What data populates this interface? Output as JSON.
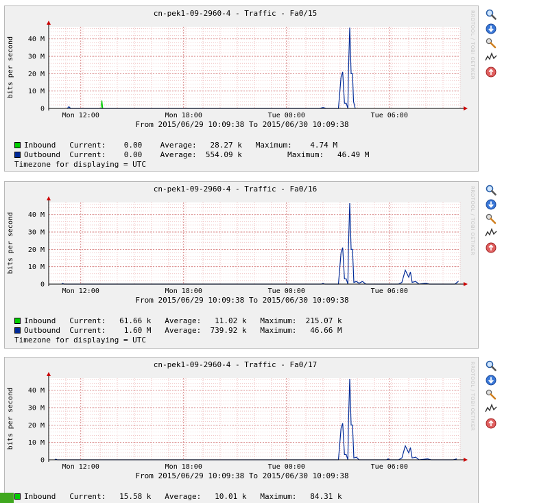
{
  "watermark": "RRDTOOL / TOBI OETIKER",
  "ylabel": "bits per second",
  "colors": {
    "inbound": "#00cc00",
    "outbound": "#002a97",
    "grid": "#e8a0a0",
    "axis": "#cc0000",
    "background": "#f0f0f0"
  },
  "actions": [
    {
      "name": "zoom-icon"
    },
    {
      "name": "download-icon"
    },
    {
      "name": "properties-icon"
    },
    {
      "name": "graph-icon"
    },
    {
      "name": "delete-icon"
    }
  ],
  "graphs": [
    {
      "title": "cn-pek1-09-2960-4 - Traffic - Fa0/15",
      "daterange": "From 2015/06/29 10:09:38 To 2015/06/30 10:09:38",
      "inbound": "Inbound   Current:    0.00    Average:   28.27 k   Maximum:    4.74 M",
      "outbound": "Outbound  Current:    0.00    Average:  554.09 k          Maximum:   46.49 M",
      "timezone": "Timezone for displaying = UTC"
    },
    {
      "title": "cn-pek1-09-2960-4 - Traffic - Fa0/16",
      "daterange": "From 2015/06/29 10:09:38 To 2015/06/30 10:09:38",
      "inbound": "Inbound   Current:   61.66 k   Average:   11.02 k   Maximum:  215.07 k",
      "outbound": "Outbound  Current:    1.60 M   Average:  739.92 k   Maximum:   46.66 M",
      "timezone": "Timezone for displaying = UTC"
    },
    {
      "title": "cn-pek1-09-2960-4 - Traffic - Fa0/17",
      "daterange": "From 2015/06/29 10:09:38 To 2015/06/30 10:09:38",
      "inbound": "Inbound   Current:   15.58 k   Average:   10.01 k   Maximum:   84.31 k"
    }
  ],
  "chart_data": [
    {
      "type": "line",
      "xlabels": [
        "Mon 12:00",
        "Mon 18:00",
        "Tue 00:00",
        "Tue 06:00"
      ],
      "ylabels": [
        "0",
        "10 M",
        "20 M",
        "30 M",
        "40 M"
      ],
      "ylim": [
        0,
        47
      ],
      "xlim_hours": [
        0,
        24
      ],
      "series": [
        {
          "name": "Inbound",
          "points": [
            [
              3.05,
              0
            ],
            [
              3.1,
              4.6
            ],
            [
              3.15,
              0
            ]
          ]
        },
        {
          "name": "Outbound",
          "points": [
            [
              1.08,
              0
            ],
            [
              1.18,
              1
            ],
            [
              1.28,
              0
            ],
            [
              15.8,
              0
            ],
            [
              16.0,
              0.5
            ],
            [
              16.2,
              0
            ],
            [
              16.9,
              0
            ],
            [
              17.05,
              18
            ],
            [
              17.15,
              21
            ],
            [
              17.25,
              3
            ],
            [
              17.35,
              3
            ],
            [
              17.45,
              0
            ],
            [
              17.48,
              20
            ],
            [
              17.56,
              46.5
            ],
            [
              17.64,
              20
            ],
            [
              17.72,
              20
            ],
            [
              17.78,
              4
            ],
            [
              17.88,
              0
            ]
          ]
        }
      ]
    },
    {
      "type": "line",
      "xlabels": [
        "Mon 12:00",
        "Mon 18:00",
        "Tue 00:00",
        "Tue 06:00"
      ],
      "ylabels": [
        "0",
        "10 M",
        "20 M",
        "30 M",
        "40 M"
      ],
      "ylim": [
        0,
        47
      ],
      "xlim_hours": [
        0,
        24
      ],
      "series": [
        {
          "name": "Inbound",
          "points": []
        },
        {
          "name": "Outbound",
          "points": [
            [
              0.75,
              0
            ],
            [
              0.82,
              0.4
            ],
            [
              0.9,
              0
            ],
            [
              15.9,
              0
            ],
            [
              16.0,
              0.4
            ],
            [
              16.1,
              0
            ],
            [
              16.9,
              0
            ],
            [
              17.05,
              18
            ],
            [
              17.15,
              21
            ],
            [
              17.25,
              3
            ],
            [
              17.35,
              3
            ],
            [
              17.45,
              0
            ],
            [
              17.48,
              20
            ],
            [
              17.56,
              46.6
            ],
            [
              17.64,
              20
            ],
            [
              17.72,
              20
            ],
            [
              17.8,
              1
            ],
            [
              17.95,
              1.5
            ],
            [
              18.1,
              0.5
            ],
            [
              18.3,
              1.5
            ],
            [
              18.5,
              0
            ],
            [
              20.4,
              0
            ],
            [
              20.6,
              1
            ],
            [
              20.8,
              8
            ],
            [
              21.0,
              4
            ],
            [
              21.1,
              7
            ],
            [
              21.2,
              1
            ],
            [
              21.4,
              1.5
            ],
            [
              21.6,
              0
            ],
            [
              22.0,
              0.5
            ],
            [
              22.2,
              0
            ],
            [
              23.7,
              0
            ],
            [
              23.9,
              1.6
            ]
          ]
        }
      ]
    },
    {
      "type": "line",
      "xlabels": [
        "Mon 12:00",
        "Mon 18:00",
        "Tue 00:00",
        "Tue 06:00"
      ],
      "ylabels": [
        "0",
        "10 M",
        "20 M",
        "30 M",
        "40 M"
      ],
      "ylim": [
        0,
        47
      ],
      "xlim_hours": [
        0,
        24
      ],
      "series": [
        {
          "name": "Inbound",
          "points": []
        },
        {
          "name": "Outbound",
          "points": [
            [
              0.35,
              0
            ],
            [
              0.42,
              0.4
            ],
            [
              0.5,
              0
            ],
            [
              16.9,
              0
            ],
            [
              17.05,
              18
            ],
            [
              17.15,
              21
            ],
            [
              17.25,
              3
            ],
            [
              17.35,
              3
            ],
            [
              17.45,
              0
            ],
            [
              17.48,
              20
            ],
            [
              17.56,
              46.6
            ],
            [
              17.64,
              20
            ],
            [
              17.72,
              20
            ],
            [
              17.8,
              1
            ],
            [
              17.95,
              1.5
            ],
            [
              18.1,
              0
            ],
            [
              19.7,
              0
            ],
            [
              19.8,
              0.5
            ],
            [
              19.9,
              0
            ],
            [
              20.4,
              0
            ],
            [
              20.6,
              1
            ],
            [
              20.8,
              8
            ],
            [
              21.0,
              4
            ],
            [
              21.1,
              7
            ],
            [
              21.2,
              1
            ],
            [
              21.4,
              1.5
            ],
            [
              21.6,
              0
            ],
            [
              22.1,
              0.5
            ],
            [
              22.3,
              0
            ],
            [
              23.6,
              0
            ],
            [
              23.8,
              0.5
            ]
          ]
        }
      ]
    }
  ]
}
